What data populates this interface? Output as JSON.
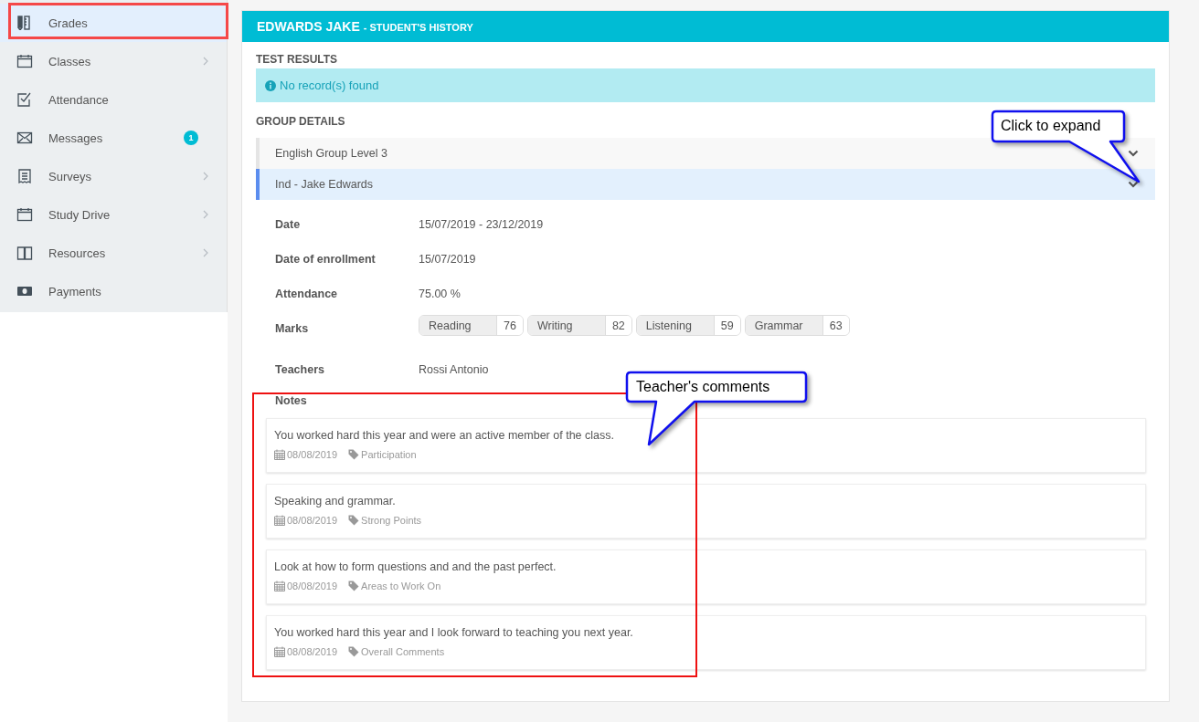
{
  "sidebar": {
    "items": [
      {
        "label": "Grades",
        "selected": true,
        "submenu": false
      },
      {
        "label": "Classes",
        "selected": false,
        "submenu": true
      },
      {
        "label": "Attendance",
        "selected": false,
        "submenu": false
      },
      {
        "label": "Messages",
        "selected": false,
        "submenu": false,
        "badge": "1"
      },
      {
        "label": "Surveys",
        "selected": false,
        "submenu": true
      },
      {
        "label": "Study Drive",
        "selected": false,
        "submenu": true
      },
      {
        "label": "Resources",
        "selected": false,
        "submenu": true
      },
      {
        "label": "Payments",
        "selected": false,
        "submenu": false
      }
    ]
  },
  "panel": {
    "title_name": "EDWARDS JAKE",
    "title_suffix": "- STUDENT'S HISTORY",
    "test_results": {
      "heading": "TEST RESULTS",
      "message": "No record(s) found"
    },
    "group_details": {
      "heading": "GROUP DETAILS",
      "groups": [
        {
          "name": "English Group Level 3",
          "expanded": false
        },
        {
          "name": "Ind - Jake Edwards",
          "expanded": true,
          "fields": [
            {
              "label": "Date",
              "value": "15/07/2019 - 23/12/2019"
            },
            {
              "label": "Date of enrollment",
              "value": "15/07/2019"
            },
            {
              "label": "Attendance",
              "value": "75.00 %"
            }
          ],
          "marks_label": "Marks",
          "marks": [
            {
              "subject": "Reading",
              "score": "76"
            },
            {
              "subject": "Writing",
              "score": "82"
            },
            {
              "subject": "Listening",
              "score": "59"
            },
            {
              "subject": "Grammar",
              "score": "63"
            }
          ],
          "teachers_label": "Teachers",
          "teachers": "Rossi Antonio",
          "notes_label": "Notes",
          "notes": [
            {
              "text": "You worked hard this year and were an active member of the class.",
              "date": "08/08/2019",
              "tag": "Participation"
            },
            {
              "text": "Speaking and grammar.",
              "date": "08/08/2019",
              "tag": "Strong Points"
            },
            {
              "text": "Look at how to form questions and and the past perfect.",
              "date": "08/08/2019",
              "tag": "Areas to Work On"
            },
            {
              "text": "You worked hard this year and I look forward to teaching you next year.",
              "date": "08/08/2019",
              "tag": "Overall Comments"
            }
          ]
        }
      ]
    }
  },
  "annotations": [
    {
      "text": "Click to expand"
    },
    {
      "text": "Teacher's comments"
    }
  ]
}
